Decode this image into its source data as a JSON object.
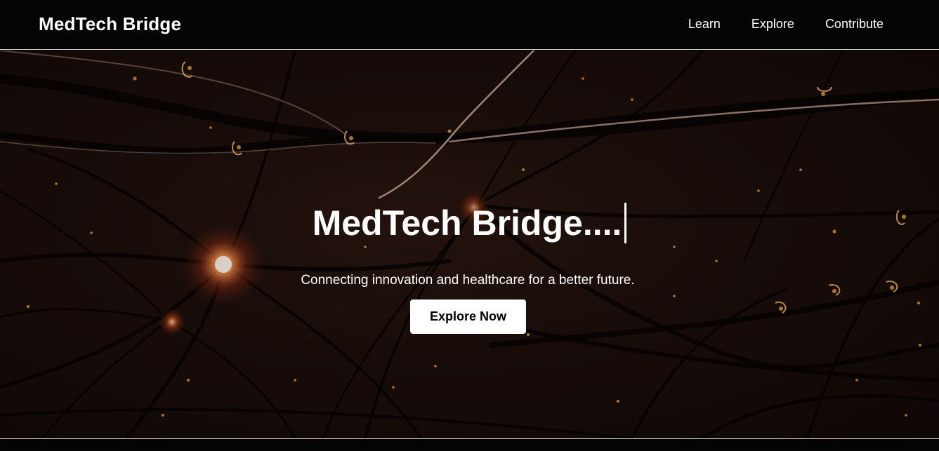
{
  "navbar": {
    "brand": "MedTech Bridge",
    "links": [
      {
        "label": "Learn"
      },
      {
        "label": "Explore"
      },
      {
        "label": "Contribute"
      }
    ]
  },
  "hero": {
    "title": "MedTech Bridge....",
    "subtitle": "Connecting innovation and healthcare for a better future.",
    "cta_label": "Explore Now",
    "background_image": "neural-network-illustration"
  },
  "colors": {
    "navbar_bg": "#040404",
    "hero_bg": "#1c0f0b",
    "glow": "#f0a030",
    "text": "#ffffff",
    "button_bg": "#ffffff",
    "button_text": "#000000"
  }
}
